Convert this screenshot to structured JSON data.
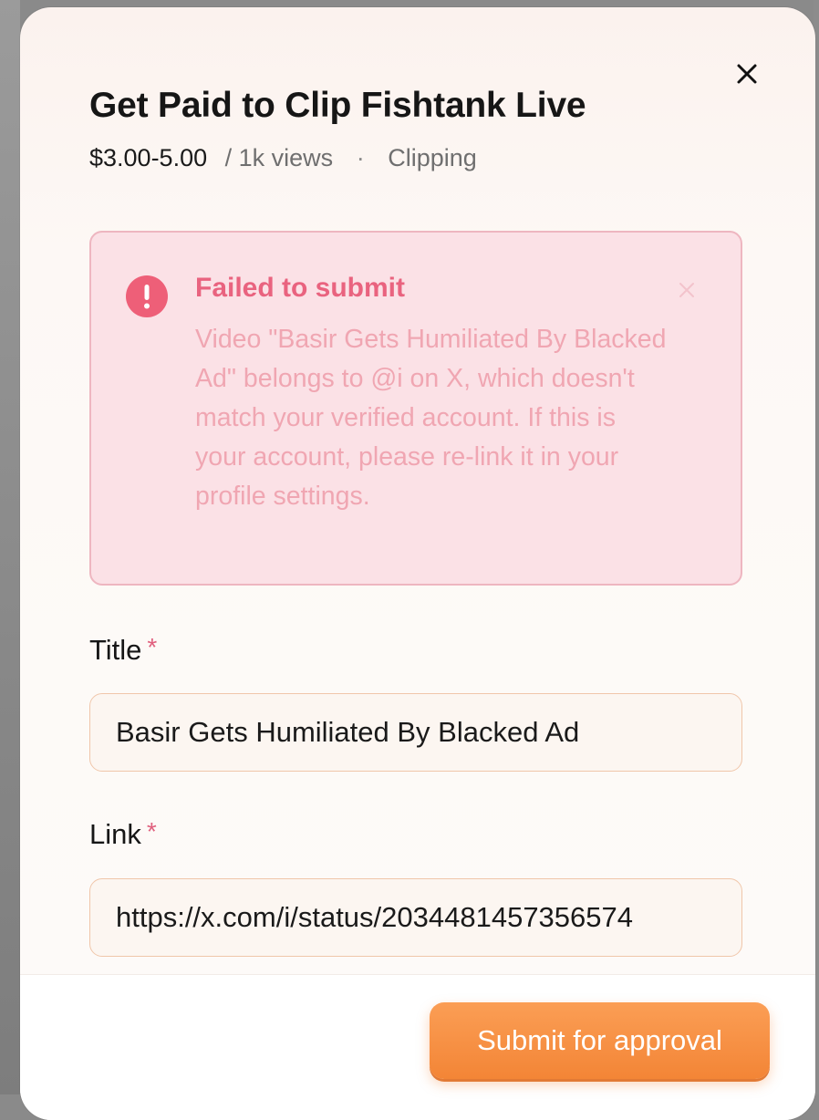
{
  "dialog": {
    "title": "Get Paid to Clip Fishtank Live",
    "price_range": "$3.00-5.00",
    "rate_unit": "/ 1k views",
    "separator": "·",
    "category": "Clipping",
    "close_icon": "close-icon"
  },
  "alert": {
    "icon": "exclamation-circle-icon",
    "title": "Failed to submit",
    "message": "Video \"Basir Gets Humiliated By Blacked Ad\" belongs to @i on X, which doesn't match your verified account. If this is your account, please re-link it in your profile settings.",
    "close_icon": "close-icon",
    "accent_color": "#e9637f",
    "background_color": "#fbe1e6"
  },
  "form": {
    "title_field": {
      "label": "Title",
      "required_mark": "*",
      "value": "Basir Gets Humiliated By Blacked Ad"
    },
    "link_field": {
      "label": "Link",
      "required_mark": "*",
      "value": "https://x.com/i/status/2034481457356574"
    }
  },
  "footer": {
    "submit_label": "Submit for approval",
    "accent_color": "#f38536"
  }
}
